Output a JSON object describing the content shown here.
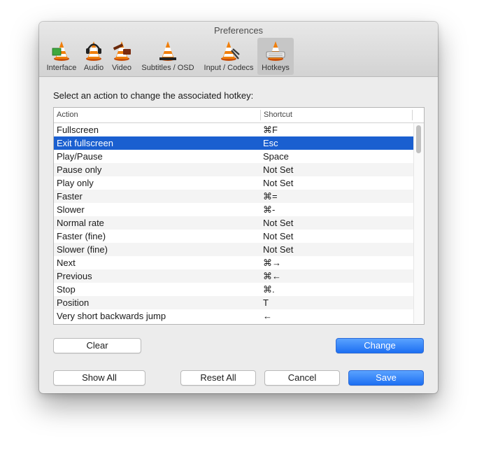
{
  "window": {
    "title": "Preferences"
  },
  "toolbar": {
    "items": [
      {
        "label": "Interface",
        "icon": "vlc-cone-interface-icon"
      },
      {
        "label": "Audio",
        "icon": "vlc-cone-headphones-icon"
      },
      {
        "label": "Video",
        "icon": "vlc-cone-video-icon"
      },
      {
        "label": "Subtitles / OSD",
        "icon": "vlc-cone-subtitles-icon"
      },
      {
        "label": "Input / Codecs",
        "icon": "vlc-cone-input-icon"
      },
      {
        "label": "Hotkeys",
        "icon": "vlc-cone-hotkeys-icon"
      }
    ],
    "selected": "Hotkeys"
  },
  "main": {
    "prompt": "Select an action to change the associated hotkey:",
    "columns": [
      "Action",
      "Shortcut"
    ],
    "rows": [
      {
        "action": "Fullscreen",
        "shortcut": "⌘F"
      },
      {
        "action": "Exit fullscreen",
        "shortcut": "Esc"
      },
      {
        "action": "Play/Pause",
        "shortcut": "Space"
      },
      {
        "action": "Pause only",
        "shortcut": "Not Set"
      },
      {
        "action": "Play only",
        "shortcut": "Not Set"
      },
      {
        "action": "Faster",
        "shortcut": "⌘="
      },
      {
        "action": "Slower",
        "shortcut": "⌘-"
      },
      {
        "action": "Normal rate",
        "shortcut": "Not Set"
      },
      {
        "action": "Faster (fine)",
        "shortcut": "Not Set"
      },
      {
        "action": "Slower (fine)",
        "shortcut": "Not Set"
      },
      {
        "action": "Next",
        "shortcut": "⌘→"
      },
      {
        "action": "Previous",
        "shortcut": "⌘←"
      },
      {
        "action": "Stop",
        "shortcut": "⌘."
      },
      {
        "action": "Position",
        "shortcut": "T"
      },
      {
        "action": "Very short backwards jump",
        "shortcut": "←"
      }
    ],
    "selected_row": "Exit fullscreen"
  },
  "buttons": {
    "clear": "Clear",
    "change": "Change",
    "show_all": "Show All",
    "reset_all": "Reset All",
    "cancel": "Cancel",
    "save": "Save"
  },
  "colors": {
    "selection": "#1a5fd0",
    "primary_button": "#1d6ff2",
    "window_bg": "#ececec"
  }
}
